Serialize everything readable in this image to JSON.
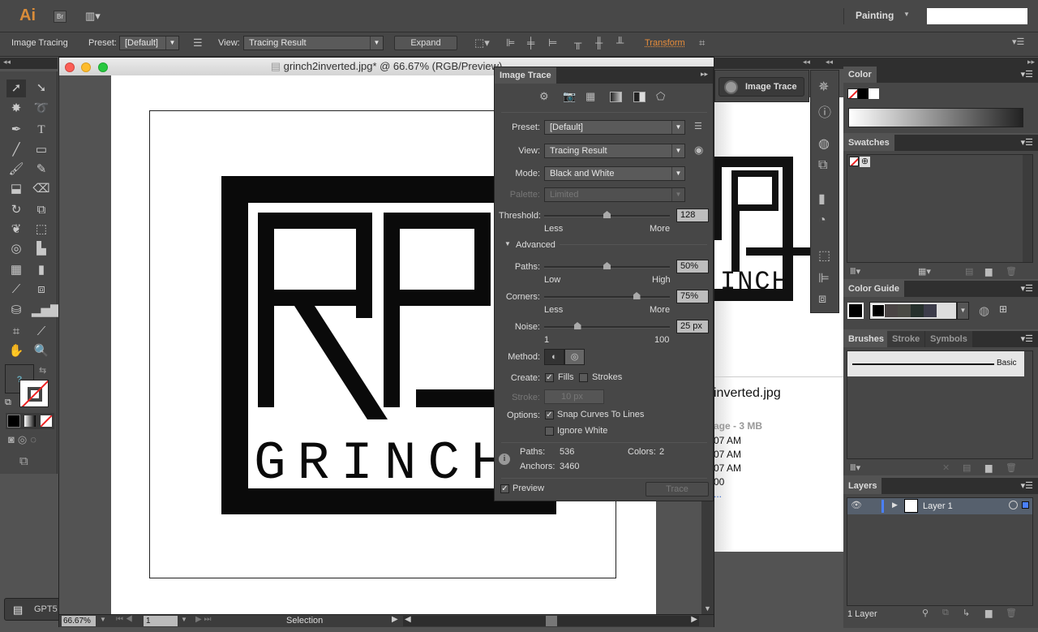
{
  "app": {
    "logo": "Ai",
    "bridge": "Br",
    "workspace": "Painting",
    "search_value": ""
  },
  "control_bar": {
    "context": "Image Tracing",
    "preset_label": "Preset:",
    "preset_value": "[Default]",
    "view_label": "View:",
    "view_value": "Tracing Result",
    "expand": "Expand",
    "transform": "Transform"
  },
  "document": {
    "title": "grinch2inverted.jpg* @ 66.67% (RGB/Preview)",
    "zoom": "66.67%",
    "artboard": "1",
    "status": "Selection",
    "art_text": "GRINCH"
  },
  "background_window": {
    "filename": "inverted.jpg",
    "kind": "age - 3 MB",
    "lines": [
      "07 AM",
      "07 AM",
      "07 AM",
      "00"
    ],
    "link": "..."
  },
  "image_trace": {
    "title": "Image Trace",
    "preset_label": "Preset:",
    "preset": "[Default]",
    "view_label": "View:",
    "view": "Tracing Result",
    "mode_label": "Mode:",
    "mode": "Black and White",
    "palette_label": "Palette:",
    "palette": "Limited",
    "threshold_label": "Threshold:",
    "threshold": "128",
    "threshold_min": "Less",
    "threshold_max": "More",
    "threshold_fraction": 0.5,
    "advanced": "Advanced",
    "paths_label": "Paths:",
    "paths": "50%",
    "paths_min": "Low",
    "paths_max": "High",
    "paths_fraction": 0.5,
    "corners_label": "Corners:",
    "corners": "75%",
    "corners_min": "Less",
    "corners_max": "More",
    "corners_fraction": 0.75,
    "noise_label": "Noise:",
    "noise": "25 px",
    "noise_min": "1",
    "noise_max": "100",
    "noise_fraction": 0.25,
    "method_label": "Method:",
    "create_label": "Create:",
    "fills": "Fills",
    "fills_checked": true,
    "strokes": "Strokes",
    "strokes_checked": false,
    "stroke_label": "Stroke:",
    "stroke": "10 px",
    "options_label": "Options:",
    "snap": "Snap Curves To Lines",
    "snap_checked": true,
    "ignore_white": "Ignore White",
    "ignore_white_checked": false,
    "info_paths_label": "Paths:",
    "info_paths": "536",
    "info_anchors_label": "Anchors:",
    "info_anchors": "3460",
    "info_colors_label": "Colors:",
    "info_colors": "2",
    "preview": "Preview",
    "preview_checked": true,
    "trace": "Trace"
  },
  "dock_button": "Image Trace",
  "panels": {
    "color": "Color",
    "swatches": "Swatches",
    "color_guide": "Color Guide",
    "brushes": "Brushes",
    "stroke": "Stroke",
    "symbols": "Symbols",
    "brush_basic": "Basic",
    "layers": "Layers",
    "layer_name": "Layer 1",
    "layer_count": "1 Layer",
    "guide_colors": [
      "#000000",
      "#4a4444",
      "#4a4a44",
      "#26302c",
      "#3c3c4a"
    ]
  },
  "taskbar": {
    "item": "GPT5"
  }
}
